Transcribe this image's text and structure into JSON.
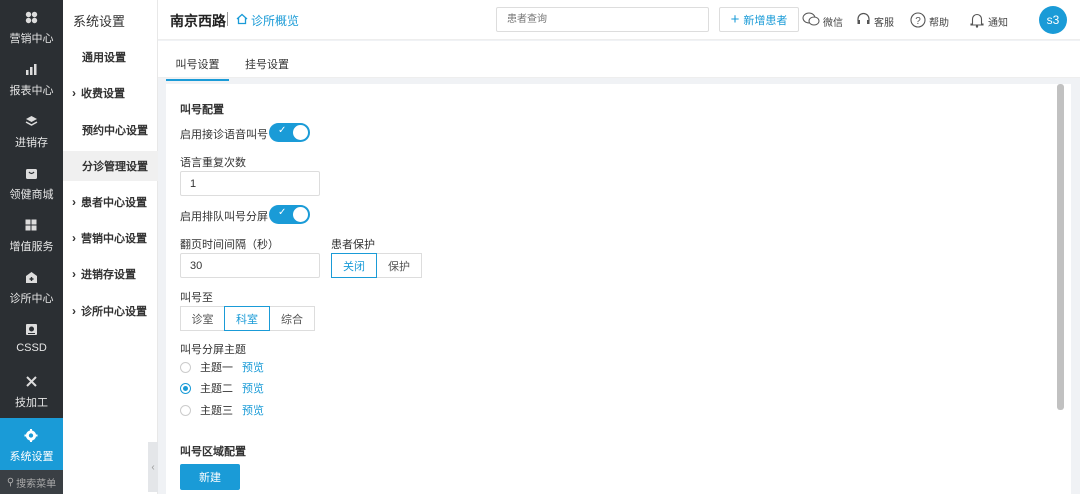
{
  "nav": {
    "items": [
      {
        "label": "营销中心",
        "icon": "flower-icon"
      },
      {
        "label": "报表中心",
        "icon": "bar-chart-icon"
      },
      {
        "label": "进销存",
        "icon": "layers-icon"
      },
      {
        "label": "领健商城",
        "icon": "shop-icon"
      },
      {
        "label": "增值服务",
        "icon": "grid-icon"
      },
      {
        "label": "诊所中心",
        "icon": "clinic-icon"
      },
      {
        "label": "CSSD",
        "icon": "sterilize-icon"
      },
      {
        "label": "技加工",
        "icon": "tools-icon"
      },
      {
        "label": "系统设置",
        "icon": "gear-icon"
      }
    ],
    "search": "搜索菜单"
  },
  "sub": {
    "title": "系统设置",
    "items": [
      {
        "label": "通用设置"
      },
      {
        "label": "收费设置"
      },
      {
        "label": "预约中心设置"
      },
      {
        "label": "分诊管理设置"
      },
      {
        "label": "患者中心设置"
      },
      {
        "label": "营销中心设置"
      },
      {
        "label": "进销存设置"
      },
      {
        "label": "诊所中心设置"
      }
    ]
  },
  "topbar": {
    "store": "南京西路",
    "overview": "诊所概览",
    "search_placeholder": "患者查询",
    "new_patient": "新增患者",
    "wechat": "微信",
    "service": "客服",
    "help": "帮助",
    "notify": "通知",
    "avatar": "s3"
  },
  "tabs": [
    {
      "label": "叫号设置"
    },
    {
      "label": "挂号设置"
    }
  ],
  "call": {
    "section": "叫号配置",
    "voice_label": "启用接诊语音叫号",
    "repeat_label": "语言重复次数",
    "repeat_value": "1",
    "screen_label": "启用排队叫号分屏",
    "interval_label": "翻页时间间隔（秒）",
    "interval_value": "30",
    "protect_label": "患者保护",
    "protect_options": [
      "关闭",
      "保护"
    ],
    "callto_label": "叫号至",
    "callto_options": [
      "诊室",
      "科室",
      "综合"
    ],
    "theme_label": "叫号分屏主题",
    "themes": [
      "主题一",
      "主题二",
      "主题三"
    ],
    "preview": "预览",
    "area_section": "叫号区域配置",
    "new_button": "新建"
  },
  "colors": {
    "accent": "#1a9bd7",
    "nav_bg": "#2b2f33"
  }
}
